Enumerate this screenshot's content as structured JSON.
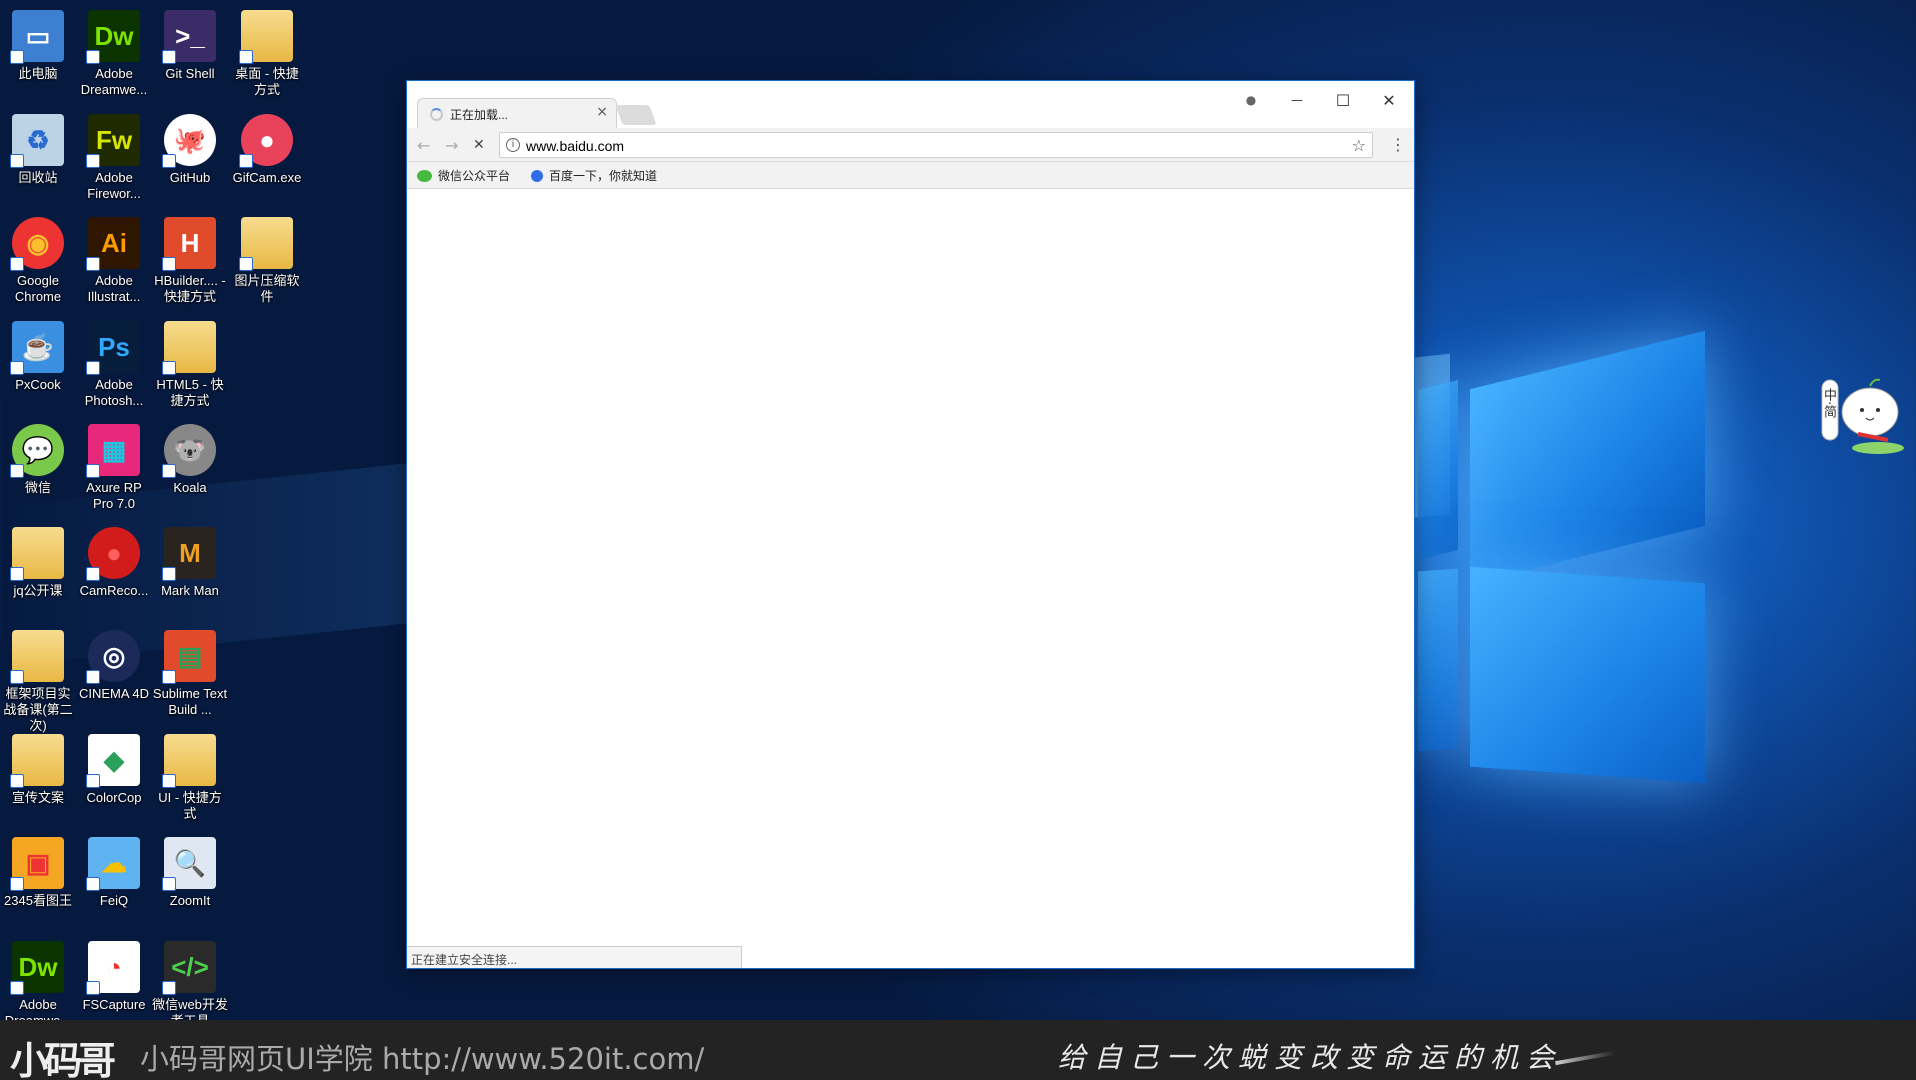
{
  "desktop_icons": [
    {
      "label": "此电脑",
      "color": "#3d7fd0",
      "glyph": "▭"
    },
    {
      "label": "Adobe Dreamwe...",
      "color": "#0a3300",
      "glyph": "Dw",
      "fg": "#7fe300"
    },
    {
      "label": "Git Shell",
      "color": "#3b2b66",
      "glyph": ">_",
      "fg": "#fff"
    },
    {
      "label": "桌面 - 快捷方式",
      "folder": true
    },
    {
      "label": "回收站",
      "color": "#bcd3e6",
      "glyph": "♻",
      "fg": "#2a6bd0"
    },
    {
      "label": "Adobe Firewor...",
      "color": "#1f2a00",
      "glyph": "Fw",
      "fg": "#d6e600"
    },
    {
      "label": "GitHub",
      "color": "#fff",
      "glyph": "🐙",
      "fg": "#6e3c9e",
      "round": true
    },
    {
      "label": "GifCam.exe",
      "color": "#e8435a",
      "glyph": "●",
      "fg": "#fff",
      "round": true
    },
    {
      "label": "Google Chrome",
      "color": "#e33",
      "glyph": "◉",
      "fg": "#fbc02d",
      "round": true
    },
    {
      "label": "Adobe Illustrat...",
      "color": "#2e1600",
      "glyph": "Ai",
      "fg": "#ff9a00"
    },
    {
      "label": "HBuilder.... - 快捷方式",
      "color": "#e04b2c",
      "glyph": "H",
      "fg": "#fff"
    },
    {
      "label": "图片压缩软件",
      "folder": true
    },
    {
      "label": "PxCook",
      "color": "#3a8fe0",
      "glyph": "☕",
      "fg": "#fff"
    },
    {
      "label": "Adobe Photosh...",
      "color": "#061e3b",
      "glyph": "Ps",
      "fg": "#31a8ff"
    },
    {
      "label": "HTML5 - 快捷方式",
      "folder": true
    },
    {
      "label": "微信",
      "color": "#7bc94a",
      "glyph": "💬",
      "fg": "#fff",
      "round": true
    },
    {
      "label": "Axure RP Pro 7.0",
      "color": "#e8287a",
      "glyph": "▦",
      "fg": "#1ec6e0"
    },
    {
      "label": "Koala",
      "color": "#888",
      "glyph": "🐨",
      "fg": "#fff",
      "round": true
    },
    {
      "label": "jq公开课",
      "folder": true
    },
    {
      "label": "CamReco...",
      "color": "#d21c1c",
      "glyph": "●",
      "fg": "#ff6060",
      "round": true
    },
    {
      "label": "Mark Man",
      "color": "#2a2420",
      "glyph": "M",
      "fg": "#f0a020"
    },
    {
      "label": "框架项目实战备课(第二次)",
      "folder": true
    },
    {
      "label": "CINEMA 4D",
      "color": "#1c2a5a",
      "glyph": "◎",
      "fg": "#fff",
      "round": true
    },
    {
      "label": "Sublime Text Build ...",
      "color": "#e24a2c",
      "glyph": "▤",
      "fg": "#2aa05a"
    },
    {
      "label": "宣传文案",
      "folder": true
    },
    {
      "label": "ColorCop",
      "color": "#fff",
      "glyph": "◆",
      "fg": "#2aa05a"
    },
    {
      "label": "UI - 快捷方式",
      "folder": true
    },
    {
      "label": "2345看图王",
      "color": "#f5a623",
      "glyph": "▣",
      "fg": "#e33"
    },
    {
      "label": "FeiQ",
      "color": "#5fb3f0",
      "glyph": "☁",
      "fg": "#f5c000"
    },
    {
      "label": "ZoomIt",
      "color": "#dfe8f2",
      "glyph": "🔍",
      "fg": "#1a6cc8"
    },
    {
      "label": "Adobe Dreamwe...",
      "color": "#0a3300",
      "glyph": "Dw",
      "fg": "#7fe300"
    },
    {
      "label": "FSCapture",
      "color": "#fff",
      "glyph": "◔",
      "fg": "#e33"
    },
    {
      "label": "微信web开发者工具",
      "color": "#2a2a2a",
      "glyph": "</>",
      "fg": "#4cd04c"
    }
  ],
  "browser": {
    "tab_title": "正在加载...",
    "tab_close": "×",
    "url": "www.baidu.com",
    "info_icon": "i",
    "star": "☆",
    "menu": "⋮",
    "nav_back": "←",
    "nav_forward": "→",
    "reload": "✕",
    "user_icon": "●",
    "minimize": "—",
    "maximize": "☐",
    "close": "✕",
    "bookmarks": [
      {
        "label": "微信公众平台",
        "icon": "wechat-icon",
        "color": "#46b93f"
      },
      {
        "label": "百度一下，你就知道",
        "icon": "baidu-paw-icon",
        "color": "#2f6ee8"
      }
    ],
    "status_text": "正在建立安全连接..."
  },
  "footer": {
    "logo": "小码哥",
    "school": "小码哥网页UI学院  http://www.520it.com/",
    "slogan": "给自己一次蜕变改变命运的机会"
  },
  "mascot_text": "中·简"
}
